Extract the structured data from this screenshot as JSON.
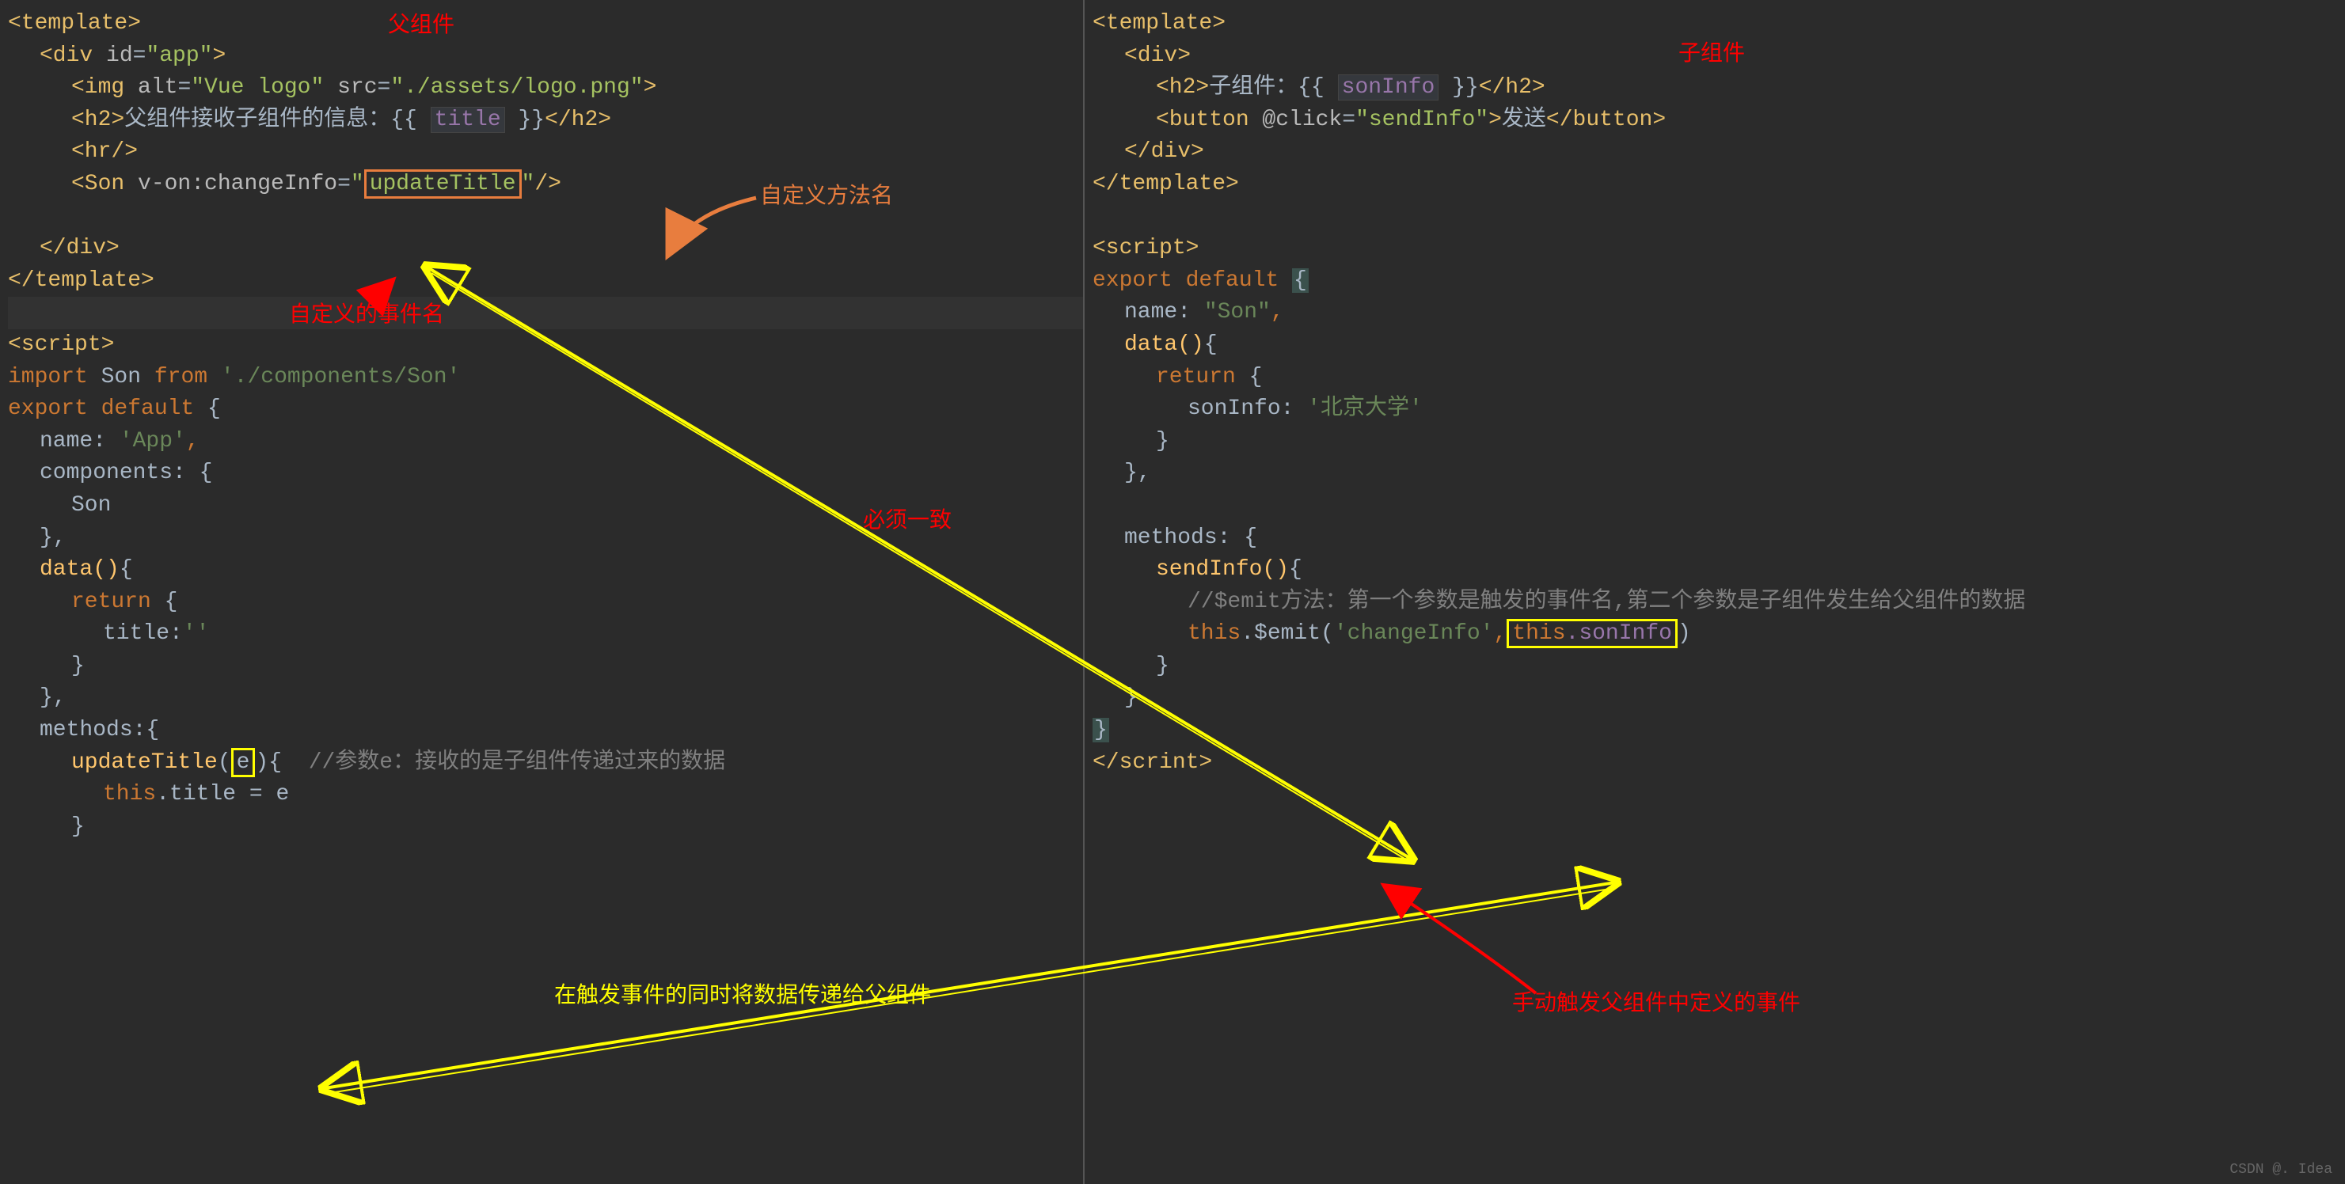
{
  "left": {
    "annotations": {
      "parent_label": "父组件",
      "custom_method": "自定义方法名",
      "custom_event": "自定义的事件名",
      "must_match": "必须一致",
      "transfer_data": "在触发事件的同时将数据传递给父组件"
    },
    "code": {
      "l1_tag": "<template>",
      "l2_open": "<div ",
      "l2_attr": "id",
      "l2_eq": "=",
      "l2_val": "\"app\"",
      "l2_close": ">",
      "l3_open": "<img ",
      "l3_attr1": "alt",
      "l3_val1": "\"Vue logo\"",
      "l3_attr2": "src",
      "l3_val2": "\"./assets/logo.png\"",
      "l3_close": ">",
      "l4_open": "<h2>",
      "l4_text": "父组件接收子组件的信息：{{ ",
      "l4_var": "title",
      "l4_text2": " }}",
      "l4_close": "</h2>",
      "l5": "<hr/>",
      "l6_open": "<Son ",
      "l6_attr": "v-on:changeInfo",
      "l6_eq": "=",
      "l6_val_pre": "\"",
      "l6_val": "updateTitle",
      "l6_val_post": "\"",
      "l6_close": "/>",
      "l7": "</div>",
      "l8": "</template>",
      "l9": "<script>",
      "l10_import": "import ",
      "l10_name": "Son ",
      "l10_from": "from ",
      "l10_path": "'./components/Son'",
      "l11": "export default ",
      "l11_brace": "{",
      "l12_key": "name: ",
      "l12_val": "'App'",
      "l12_comma": ",",
      "l13": "components: {",
      "l14": "Son",
      "l15": "},",
      "l16": "data()",
      "l16_brace": "{",
      "l17": "return ",
      "l17_brace": "{",
      "l18_key": "title:",
      "l18_val": "''",
      "l19": "}",
      "l20": "},",
      "l21": "methods:",
      "l21_brace": "{",
      "l22_method": "updateTitle",
      "l22_paren": "(",
      "l22_param": "e",
      "l22_paren2": ")",
      "l22_brace": "{",
      "l22_comment": "  //参数e：接收的是子组件传递过来的数据",
      "l23_this": "this",
      "l23_rest": ".title = e",
      "l24": "}"
    }
  },
  "right": {
    "annotations": {
      "child_label": "子组件",
      "manual_trigger": "手动触发父组件中定义的事件"
    },
    "code": {
      "l1": "<template>",
      "l2": "<div>",
      "l3_open": "<h2>",
      "l3_text": "子组件：{{ ",
      "l3_var": "sonInfo",
      "l3_text2": " }}",
      "l3_close": "</h2>",
      "l4_open": "<button ",
      "l4_attr": "@click",
      "l4_eq": "=",
      "l4_val": "\"sendInfo\"",
      "l4_close": ">",
      "l4_text": "发送",
      "l4_close2": "</button>",
      "l5": "</div>",
      "l6": "</template>",
      "l7": "<script>",
      "l8": "export default ",
      "l8_brace": "{",
      "l9_key": "name: ",
      "l9_val": "\"Son\"",
      "l9_comma": ",",
      "l10": "data()",
      "l10_brace": "{",
      "l11": "return ",
      "l11_brace": "{",
      "l12_key": "sonInfo: ",
      "l12_val": "'北京大学'",
      "l13": "}",
      "l14": "},",
      "l15": "methods: ",
      "l15_brace": "{",
      "l16": "sendInfo()",
      "l16_brace": "{",
      "l17_comment": "//$emit方法：第一个参数是触发的事件名,第二个参数是子组件发生给父组件的数据",
      "l18_this": "this",
      "l18_dot": ".$emit(",
      "l18_arg1": "'changeInfo'",
      "l18_comma": ",",
      "l18_arg2_this": "this",
      "l18_arg2_rest": ".sonInfo",
      "l18_close": ")",
      "l19": "}",
      "l20": "}",
      "l21": "}",
      "l22": "</scrint>"
    }
  },
  "watermark": "CSDN @. Idea"
}
